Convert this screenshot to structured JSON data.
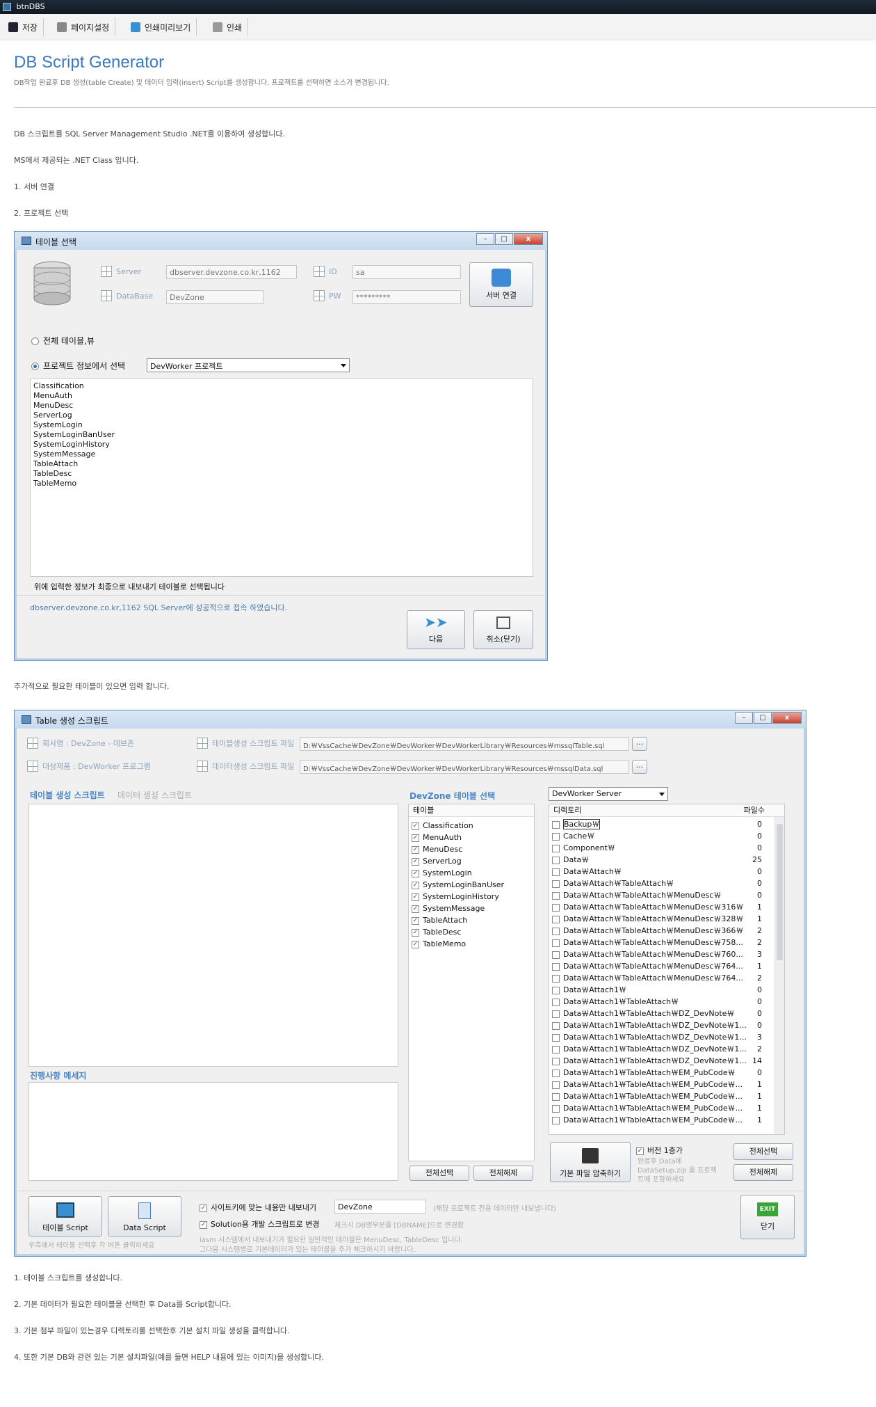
{
  "window_title": "btnDBS",
  "toolbar": [
    {
      "label": "저장",
      "icon": "save-icon"
    },
    {
      "label": "페이지설정",
      "icon": "page-setup-icon"
    },
    {
      "label": "인쇄미리보기",
      "icon": "print-preview-icon"
    },
    {
      "label": "인쇄",
      "icon": "print-icon"
    }
  ],
  "header": {
    "title": "DB Script Generator",
    "subtitle": "DB작업 완료후 DB 생성(table Create) 및 데이터 입력(insert) Script를 생성합니다. 프로젝트를 선택하면 소스가 변경됩니다."
  },
  "intro": {
    "p1": "DB 스크립트를 SQL Server Management Studio .NET를 이용하여 생성합니다.",
    "p2": "MS에서 제공되는 .NET Class 입니다.",
    "p3": "1. 서버 연결",
    "p4": "2. 프로젝트 선택"
  },
  "dialog1": {
    "title": "테이블 선택",
    "server_label": "Server",
    "server_value": "dbserver.devzone.co.kr,1162",
    "database_label": "DataBase",
    "database_value": "DevZone",
    "id_label": "ID",
    "id_value": "sa",
    "pw_label": "PW",
    "pw_value": "*********",
    "connect_button": "서버 연결",
    "radio_all": "전체 테이블,뷰",
    "radio_project": "프로젝트 정보에서 선택",
    "project_select": "DevWorker 프로젝트",
    "tables": [
      "Classification",
      "MenuAuth",
      "MenuDesc",
      "ServerLog",
      "SystemLogin",
      "SystemLoginBanUser",
      "SystemLoginHistory",
      "SystemMessage",
      "TableAttach",
      "TableDesc",
      "TableMemo"
    ],
    "hint": "위에 입력한 정보가 최종으로 내보내기 테이블로 선택됩니다",
    "status": "dbserver.devzone.co.kr,1162 SQL Server에 성공적으로 접속 하였습니다.",
    "next_button": "다음",
    "cancel_button": "취소(닫기)"
  },
  "mid_text": "추가적으로 필요한 테이블이 있으면 입력 합니다.",
  "dialog2": {
    "title": "Table 생성 스크립트",
    "company": "회사명 : DevZone - 데브존",
    "product": "대상제품 : DevWorker 프로그램",
    "table_script_file_label": "테이블생성 스크립트 파일",
    "table_script_file": "D:￦VssCache￦DevZone￦DevWorker￦DevWorkerLibrary￦Resources￦mssqlTable.sql",
    "data_script_file_label": "데이터생성 스크립트 파일",
    "data_script_file": "D:￦VssCache￦DevZone￦DevWorker￦DevWorkerLibrary￦Resources￦mssqlData.sql",
    "browse": "...",
    "tab_table": "테이블 생성 스크립트",
    "tab_data": "데이터 생성 스크립트",
    "progress_title": "진행사항 메세지",
    "devzone_select_title": "DevZone 테이블 선택",
    "table_header": "테이블",
    "tables": [
      "Classification",
      "MenuAuth",
      "MenuDesc",
      "ServerLog",
      "SystemLogin",
      "SystemLoginBanUser",
      "SystemLoginHistory",
      "SystemMessage",
      "TableAttach",
      "TableDesc",
      "TableMemo"
    ],
    "select_all": "전체선택",
    "deselect_all": "전체해제",
    "server_select": "DevWorker Server",
    "dir_header": "디렉토리",
    "count_header": "파일수",
    "dirs": [
      {
        "name": "Backup￦",
        "count": "0"
      },
      {
        "name": "Cache￦",
        "count": "0"
      },
      {
        "name": "Component￦",
        "count": "0"
      },
      {
        "name": "Data￦",
        "count": "25"
      },
      {
        "name": "Data￦Attach￦",
        "count": "0"
      },
      {
        "name": "Data￦Attach￦TableAttach￦",
        "count": "0"
      },
      {
        "name": "Data￦Attach￦TableAttach￦MenuDesc￦",
        "count": "0"
      },
      {
        "name": "Data￦Attach￦TableAttach￦MenuDesc￦316￦",
        "count": "1"
      },
      {
        "name": "Data￦Attach￦TableAttach￦MenuDesc￦328￦",
        "count": "1"
      },
      {
        "name": "Data￦Attach￦TableAttach￦MenuDesc￦366￦",
        "count": "2"
      },
      {
        "name": "Data￦Attach￦TableAttach￦MenuDesc￦758...",
        "count": "2"
      },
      {
        "name": "Data￦Attach￦TableAttach￦MenuDesc￦760...",
        "count": "3"
      },
      {
        "name": "Data￦Attach￦TableAttach￦MenuDesc￦764...",
        "count": "1"
      },
      {
        "name": "Data￦Attach￦TableAttach￦MenuDesc￦764...",
        "count": "2"
      },
      {
        "name": "Data￦Attach1￦",
        "count": "0"
      },
      {
        "name": "Data￦Attach1￦TableAttach￦",
        "count": "0"
      },
      {
        "name": "Data￦Attach1￦TableAttach￦DZ_DevNote￦",
        "count": "0"
      },
      {
        "name": "Data￦Attach1￦TableAttach￦DZ_DevNote￦1...",
        "count": "0"
      },
      {
        "name": "Data￦Attach1￦TableAttach￦DZ_DevNote￦1...",
        "count": "3"
      },
      {
        "name": "Data￦Attach1￦TableAttach￦DZ_DevNote￦1...",
        "count": "2"
      },
      {
        "name": "Data￦Attach1￦TableAttach￦DZ_DevNote￦1...",
        "count": "14"
      },
      {
        "name": "Data￦Attach1￦TableAttach￦EM_PubCode￦",
        "count": "0"
      },
      {
        "name": "Data￦Attach1￦TableAttach￦EM_PubCode￦...",
        "count": "1"
      },
      {
        "name": "Data￦Attach1￦TableAttach￦EM_PubCode￦...",
        "count": "1"
      },
      {
        "name": "Data￦Attach1￦TableAttach￦EM_PubCode￦...",
        "count": "1"
      },
      {
        "name": "Data￦Attach1￦TableAttach￦EM_PubCode￦...",
        "count": "1"
      }
    ],
    "zip_button": "기본 파일 압축하기",
    "version_check": "버전 1증가",
    "version_note": "완료후 Data에 DataSetup.zip 을 프로젝트에 포함하세요",
    "dir_select_all": "전체선택",
    "dir_deselect_all": "전체해제",
    "table_script_button": "테이블 Script",
    "data_script_button": "Data Script",
    "bottom_hint": "우측에서 테이블 선택후 각 버튼 클릭하세요",
    "opt_site": "사이트키에 맞는 내용만 내보내기",
    "opt_site_value": "DevZone",
    "opt_site_note": "(해당 프로젝트 전용 데이터만 내보냅니다)",
    "opt_solution": "Solution용 개발 스크립트로 변경",
    "opt_solution_note": "체크시 DB명부분을 [DBNAME]으로 변경함",
    "footer_note1": "iasm 시스템에서 내보내기가 필요한 일반적인 테이블은 MenuDesc, TableDesc 입니다.",
    "footer_note2": "그다음 시스템별로 기본데이터가 있는 테이블을 추가 체크하시기 바랍니다.",
    "close_button": "닫기",
    "exit_label": "EXIT"
  },
  "steps": [
    "1. 테이블 스크립트를 생성합니다.",
    "2. 기본 데이터가 필요한 테이블을 선택한 후 Data를 Script합니다.",
    "3. 기본 첨부 파일이 있는경우 디렉토리를 선택한후 기본 설치 파일 생성을 클릭합니다.",
    "4. 또한 기본 DB와 관련 있는 기본 설치파일(예를 들면 HELP 내용에 있는 이미지)을 생성합니다."
  ]
}
